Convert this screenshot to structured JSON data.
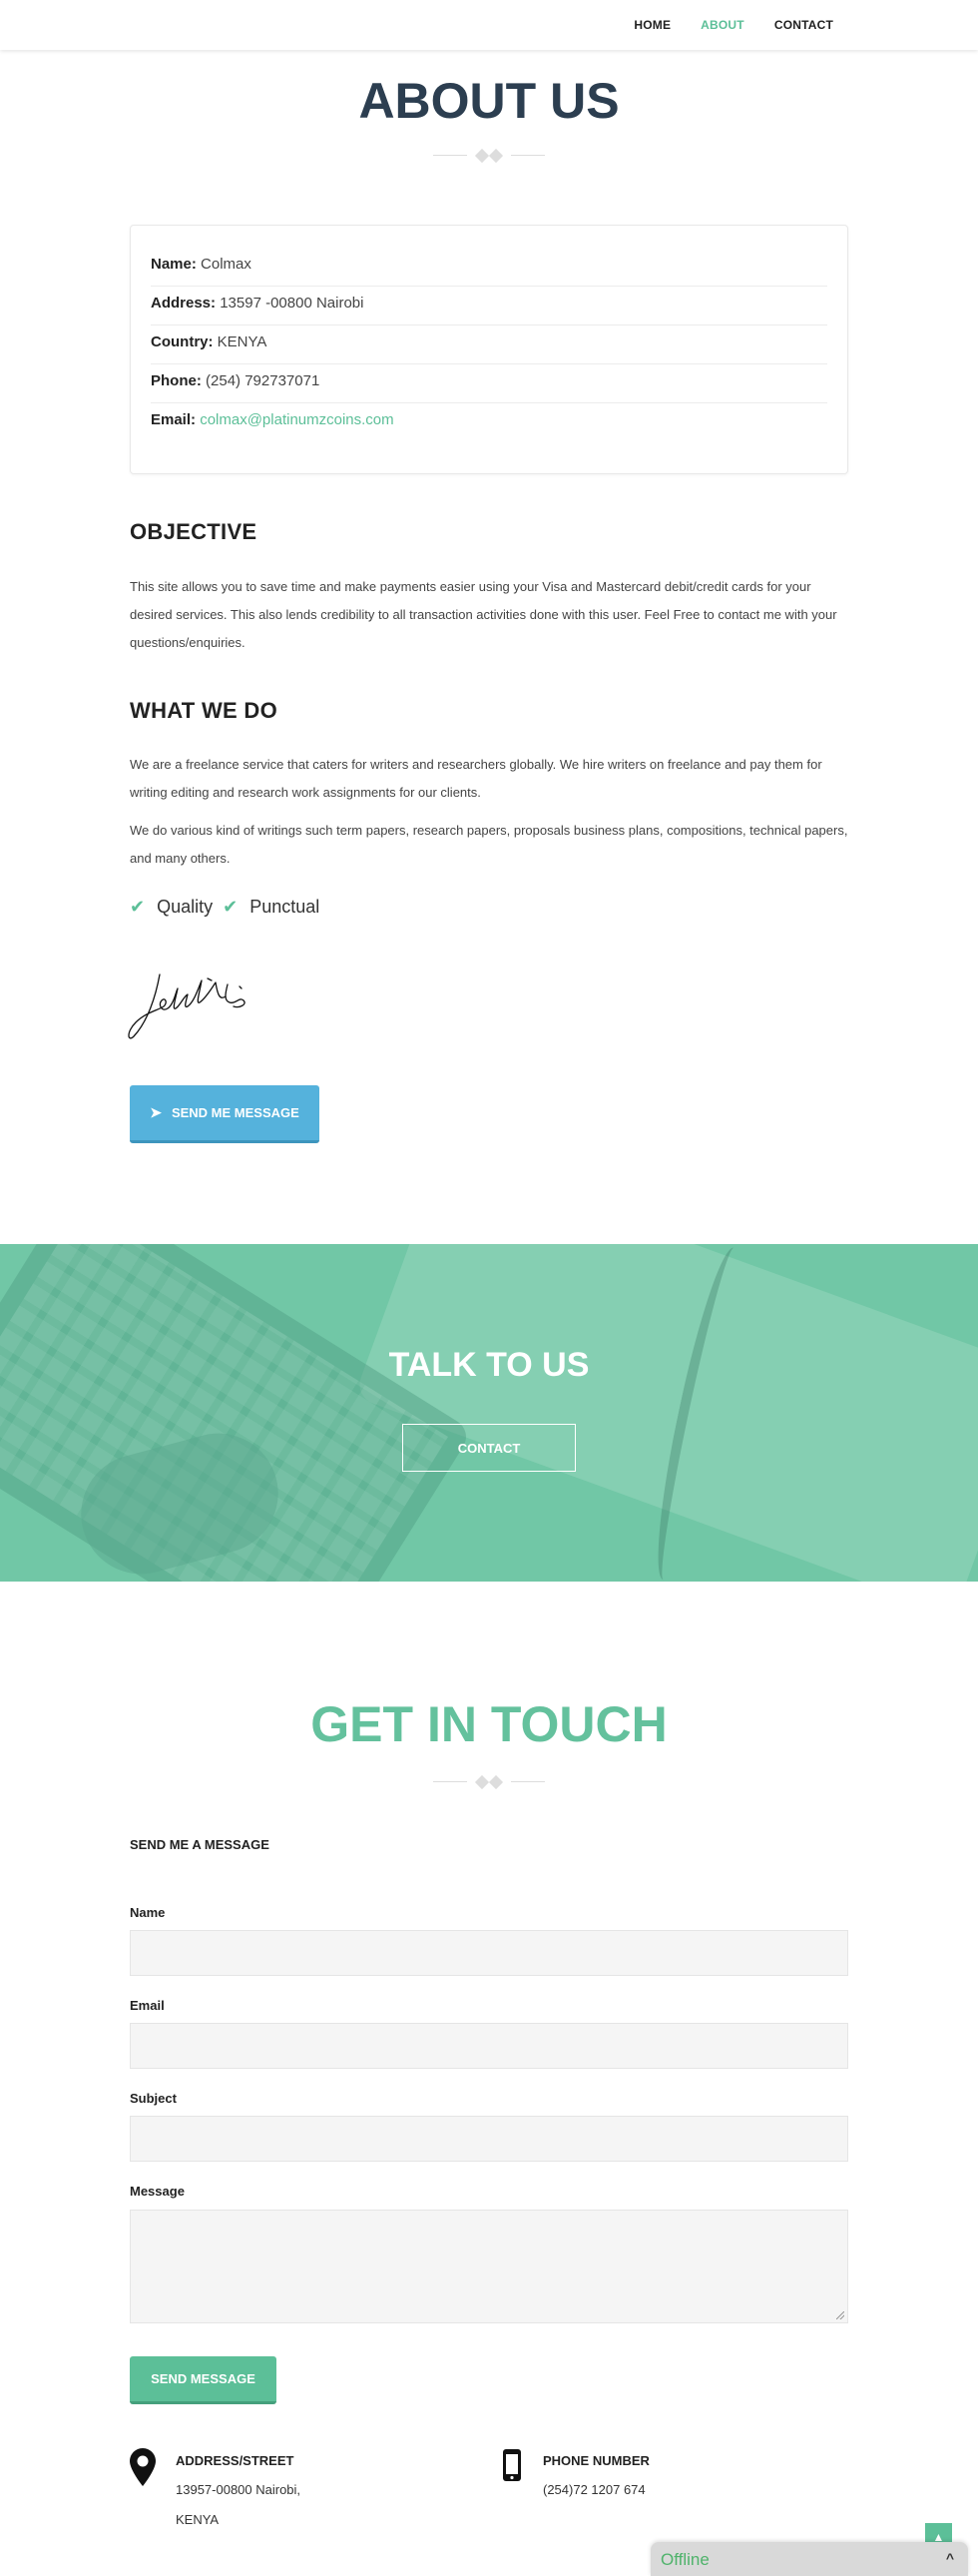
{
  "nav": {
    "items": [
      {
        "label": "HOME"
      },
      {
        "label": "ABOUT"
      },
      {
        "label": "CONTACT"
      }
    ]
  },
  "about": {
    "title": "ABOUT US",
    "info": {
      "name_label": "Name:",
      "name_value": "Colmax",
      "address_label": "Address:",
      "address_value": "13597 -00800 Nairobi",
      "country_label": "Country:",
      "country_value": "KENYA",
      "phone_label": "Phone:",
      "phone_value": "(254) 792737071",
      "email_label": "Email:",
      "email_value": "colmax@platinumzcoins.com"
    },
    "objective_title": "OBJECTIVE",
    "objective_text": "This site allows you to save time and make payments easier using your Visa and Mastercard debit/credit cards for your desired services. This also lends credibility to all transaction activities done with this user. Feel Free to contact me with your questions/enquiries.",
    "whatwedo_title": "WHAT WE DO",
    "whatwedo_p1": "We are a freelance service that caters for writers and researchers globally. We hire writers on freelance and pay them for writing editing and research work assignments for our clients.",
    "whatwedo_p2": "We do various kind of writings such term papers, research papers, proposals business plans, compositions, technical papers, and many others.",
    "features": [
      "Quality",
      "Punctual"
    ],
    "send_me_message_label": "SEND ME MESSAGE"
  },
  "talk": {
    "title": "TALK TO US",
    "button_label": "CONTACT"
  },
  "get_in_touch": {
    "title": "GET IN TOUCH",
    "form_heading": "SEND ME A MESSAGE",
    "fields": {
      "name": "Name",
      "email": "Email",
      "subject": "Subject",
      "message": "Message"
    },
    "submit_label": "SEND MESSAGE",
    "address": {
      "heading": "ADDRESS/STREET",
      "line1": "13957-00800 Nairobi,",
      "line2": "KENYA"
    },
    "phone": {
      "heading": "PHONE NUMBER",
      "value": "(254)72 1207 674"
    }
  },
  "chat": {
    "status": "Offline"
  },
  "colors": {
    "accent": "#5cbf98",
    "dark_heading": "#2c3e50",
    "button_blue": "#55b2dc"
  }
}
